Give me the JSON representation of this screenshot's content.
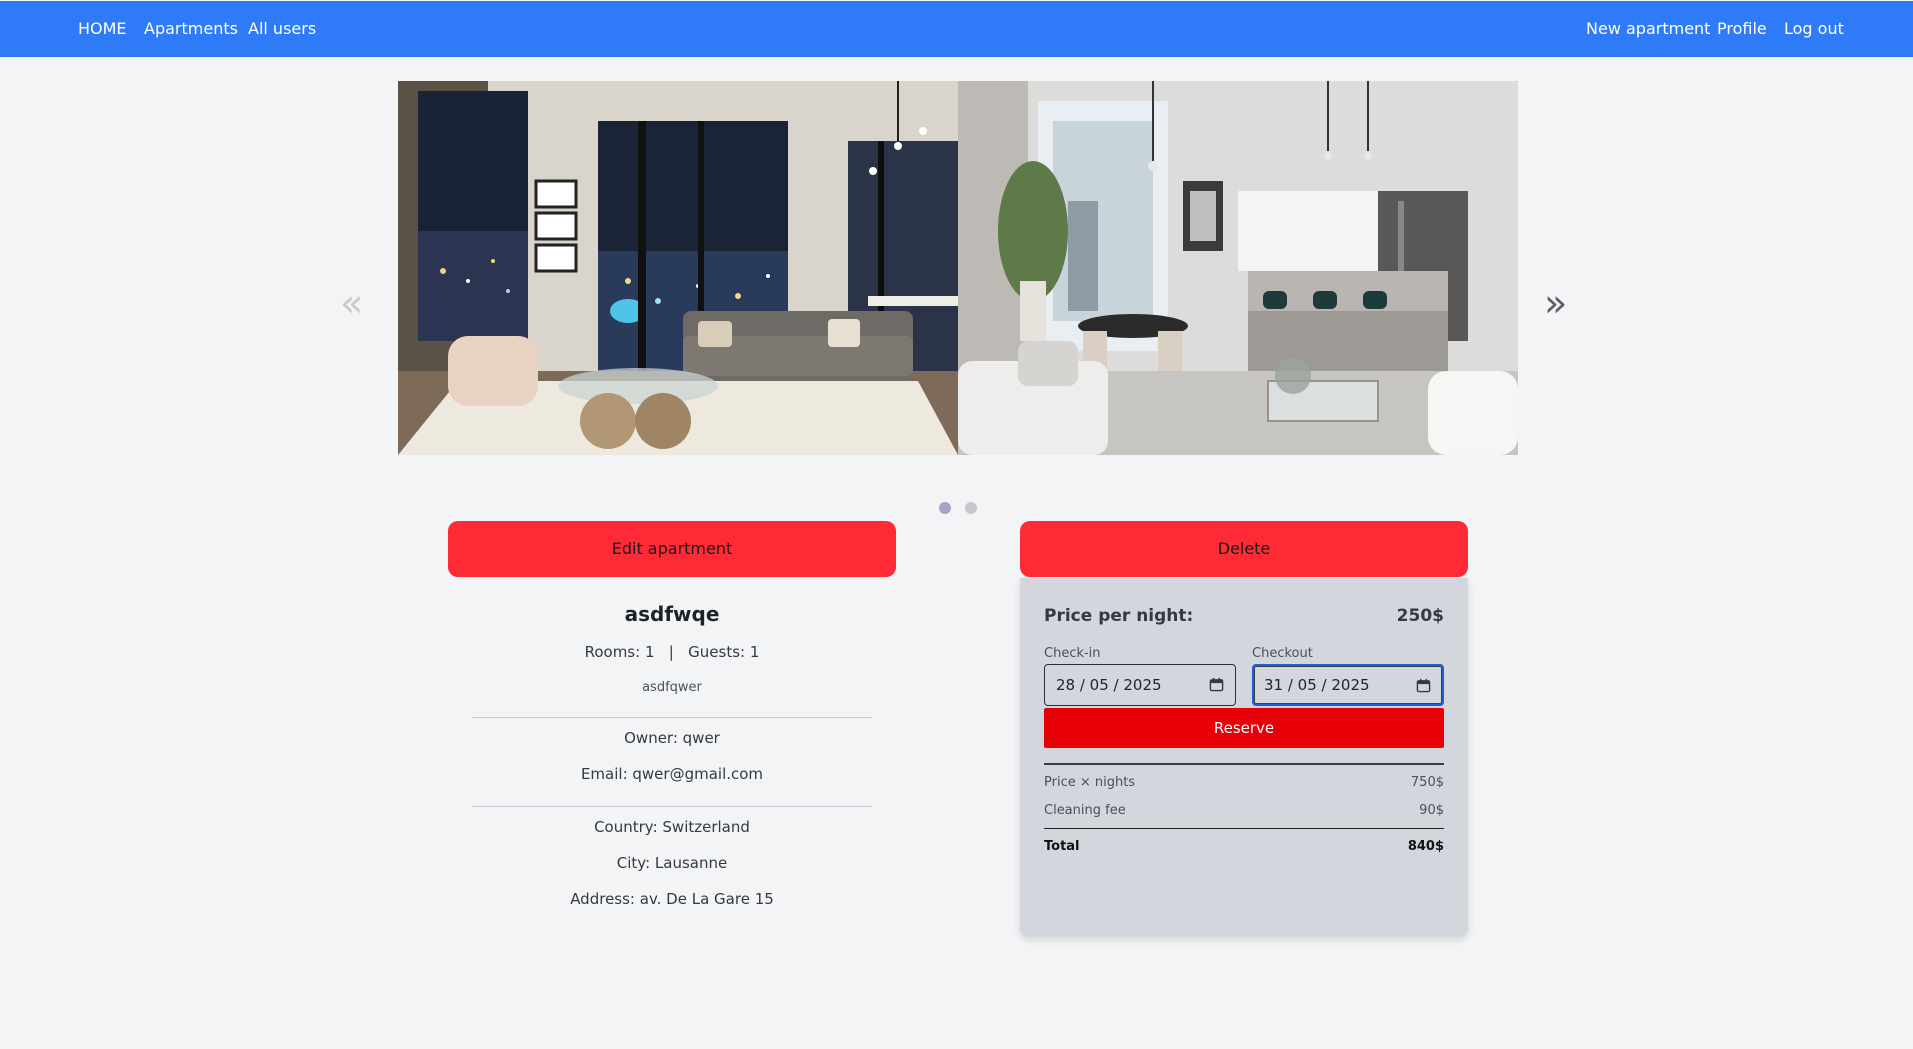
{
  "navbar": {
    "left_links": [
      "HOME",
      "Apartments",
      "All users"
    ],
    "right_links": [
      "New apartment",
      "Profile",
      "Log out"
    ]
  },
  "carousel": {
    "prev_arrow": "«",
    "next_arrow": "»",
    "slides": [
      "living-room-night-photo",
      "living-room-kitchen-day-photo"
    ],
    "active_index": 0
  },
  "actions": {
    "edit_label": "Edit apartment",
    "delete_label": "Delete"
  },
  "apartment": {
    "title": "asdfwqe",
    "rooms_guests": "Rooms: 1   |   Guests: 1",
    "description": "asdfqwer",
    "owner": "Owner: qwer",
    "email": "Email: qwer@gmail.com",
    "country": "Country: Switzerland",
    "city": "City: Lausanne",
    "address": "Address: av. De La Gare 15"
  },
  "booking": {
    "price_label": "Price per night:",
    "price_value": "250$",
    "checkin_label": "Check-in",
    "checkin_value": "28 / 05 / 2025",
    "checkout_label": "Checkout",
    "checkout_value": "31 / 05 / 2025",
    "reserve_label": "Reserve",
    "breakdown": [
      {
        "label": "Price × nights",
        "value": "750$"
      },
      {
        "label": "Cleaning fee",
        "value": "90$"
      }
    ],
    "total_label": "Total",
    "total_value": "840$"
  },
  "colors": {
    "navbar": "#2f7bf7",
    "action_button": "#fe2b37",
    "reserve_button": "#e80009",
    "card": "#d3d6dc"
  }
}
